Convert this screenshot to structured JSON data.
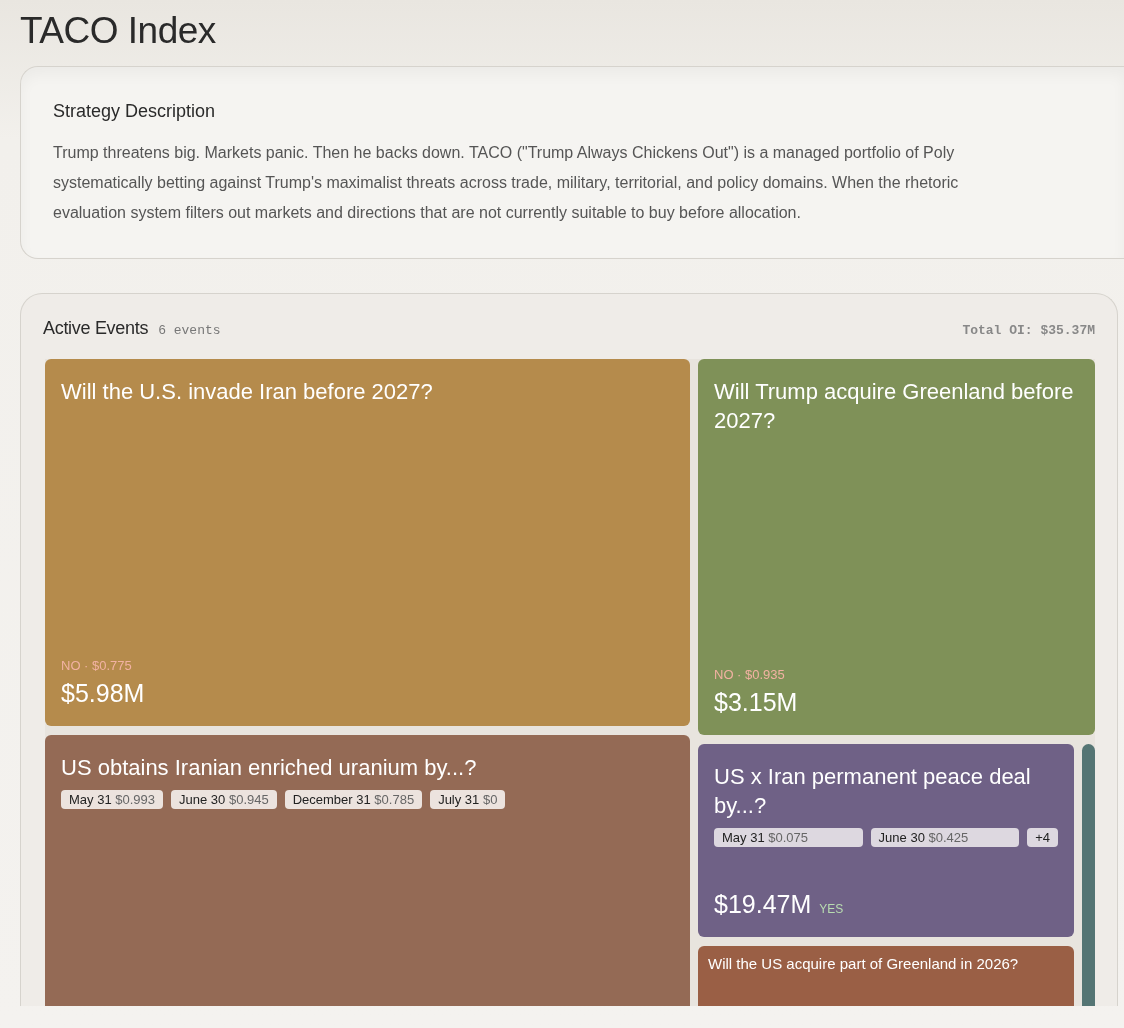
{
  "page_title": "TACO Index",
  "strategy": {
    "heading": "Strategy Description",
    "lines": [
      "Trump threatens big. Markets panic. Then he backs down. TACO (\"Trump Always Chickens Out\") is a managed portfolio of Poly",
      "systematically betting against Trump's maximalist threats across trade, military, territorial, and policy domains. When the rhetoric",
      "evaluation system filters out markets and directions that are not currently suitable to buy before allocation."
    ]
  },
  "active_events": {
    "heading": "Active Events",
    "count": "6 events",
    "total": "Total OI: $35.37M",
    "events": [
      {
        "kind": "binary",
        "title": "Will the U.S. invade Iran before 2027?",
        "color": "#b58b4c",
        "outcome": "NO · $0.775",
        "amount": "$5.98M"
      },
      {
        "kind": "binary",
        "title": "Will Trump acquire Greenland before 2027?",
        "color": "#7f9158",
        "outcome": "NO · $0.935",
        "amount": "$3.15M"
      },
      {
        "kind": "multi",
        "title": "US obtains Iranian enriched uranium by...?",
        "color": "#946a55",
        "outcomes": [
          {
            "date": "May 31",
            "price": "$0.993"
          },
          {
            "date": "June 30",
            "price": "$0.945"
          },
          {
            "date": "December 31",
            "price": "$0.785"
          },
          {
            "date": "July 31",
            "price": "$0"
          }
        ]
      },
      {
        "kind": "multi",
        "title": "US x Iran permanent peace deal by...?",
        "color": "#6f6186",
        "outcomes": [
          {
            "date": "May 31",
            "price": "$0.075"
          },
          {
            "date": "June 30",
            "price": "$0.425"
          }
        ],
        "more": "+4",
        "amount": "$19.47M",
        "outcome": "YES"
      },
      {
        "kind": "compact",
        "title": "Will the US acquire part of Greenland in 2026?",
        "color": "#9a5f45"
      },
      {
        "kind": "strip",
        "color": "#557574"
      }
    ]
  }
}
